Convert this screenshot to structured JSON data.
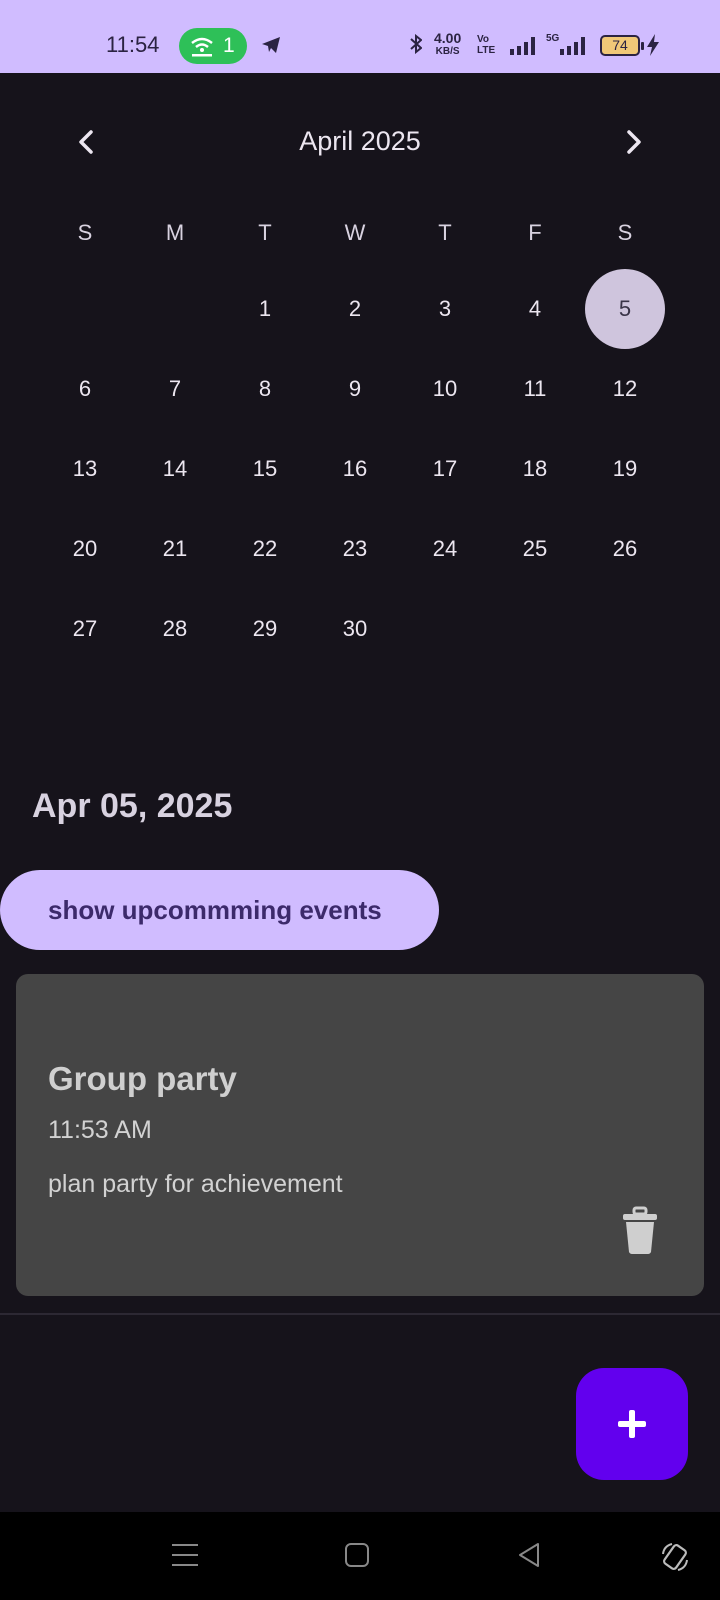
{
  "status_bar": {
    "time": "11:54",
    "hotspot_count": "1",
    "net_speed_value": "4.00",
    "net_speed_unit": "KB/S",
    "volte_top": "Vo",
    "volte_bottom": "LTE",
    "network_type": "5G",
    "battery": "74"
  },
  "calendar": {
    "month_title": "April 2025",
    "weekdays": [
      "S",
      "M",
      "T",
      "W",
      "T",
      "F",
      "S"
    ],
    "selected_day": "5",
    "days": [
      "1",
      "2",
      "3",
      "4",
      "5",
      "6",
      "7",
      "8",
      "9",
      "10",
      "11",
      "12",
      "13",
      "14",
      "15",
      "16",
      "17",
      "18",
      "19",
      "20",
      "21",
      "22",
      "23",
      "24",
      "25",
      "26",
      "27",
      "28",
      "29",
      "30"
    ]
  },
  "selected_date": "Apr 05, 2025",
  "upcoming_button": "show upcommming events",
  "event": {
    "title": "Group party",
    "time": "11:53 AM",
    "description": "plan party for achievement"
  },
  "icons": {
    "prev": "chevron-left-icon",
    "next": "chevron-right-icon",
    "delete": "trash-icon",
    "add": "plus-icon"
  },
  "colors": {
    "accent": "#d0bcff",
    "fab": "#6200ee",
    "background": "#16131b",
    "card": "#454545"
  }
}
